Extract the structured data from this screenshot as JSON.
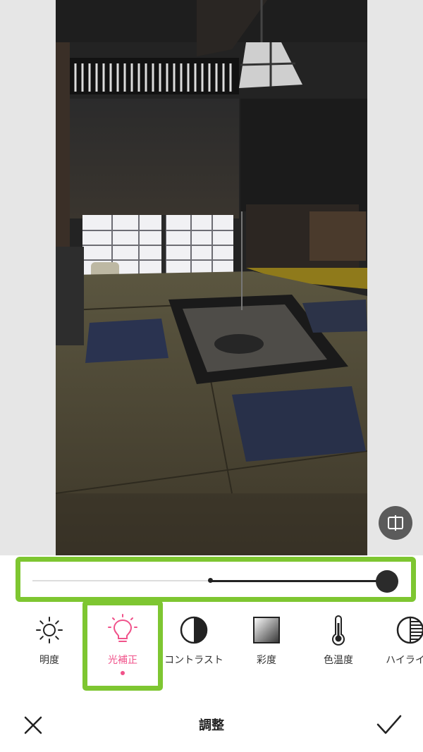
{
  "editor": {
    "title": "調整"
  },
  "slider": {
    "value_fraction": 1.0
  },
  "tools": [
    {
      "name": "brightness",
      "label": "明度",
      "icon": "sun-icon",
      "active": false
    },
    {
      "name": "exposure",
      "label": "光補正",
      "icon": "lightbulb-icon",
      "active": true
    },
    {
      "name": "contrast",
      "label": "コントラスト",
      "icon": "half-circle-icon",
      "active": false
    },
    {
      "name": "saturation",
      "label": "彩度",
      "icon": "gradient-square-icon",
      "active": false
    },
    {
      "name": "temperature",
      "label": "色温度",
      "icon": "thermometer-icon",
      "active": false
    },
    {
      "name": "highlight",
      "label": "ハイライト",
      "icon": "striped-circle-icon",
      "active": false
    }
  ],
  "colors": {
    "accent": "#f0528a",
    "highlight_frame": "#7ec631",
    "icon": "#222222"
  }
}
